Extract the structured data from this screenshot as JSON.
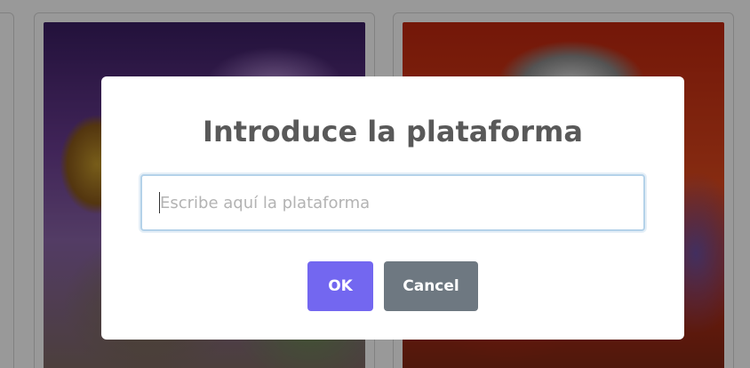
{
  "modal": {
    "title": "Introduce la plataforma",
    "input": {
      "value": "",
      "placeholder": "Escribe aquí la plataforma"
    },
    "buttons": {
      "ok_label": "OK",
      "cancel_label": "Cancel"
    }
  },
  "colors": {
    "confirm_button": "#7367f0",
    "cancel_button": "#6e7881",
    "input_focus_border": "#b4d2e9",
    "title_text": "#595959",
    "backdrop": "rgba(0,0,0,0.4)"
  }
}
